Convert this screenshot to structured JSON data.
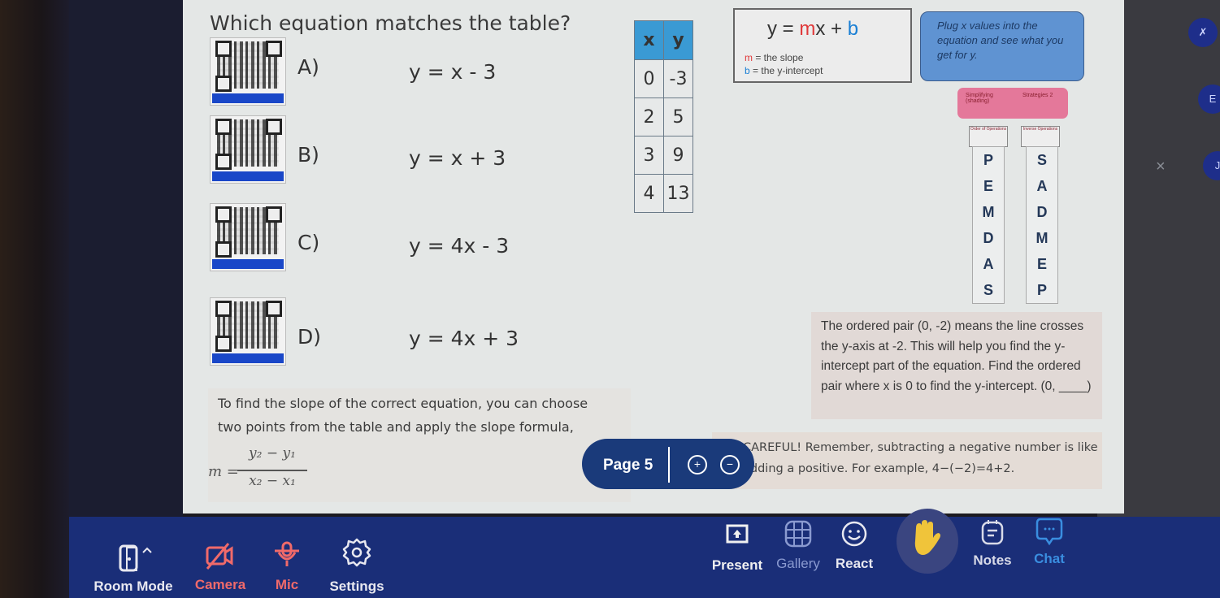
{
  "question": {
    "title": "Which equation matches the table?",
    "options": [
      {
        "letter": "A)",
        "equation": "y = x - 3"
      },
      {
        "letter": "B)",
        "equation": "y = x + 3"
      },
      {
        "letter": "C)",
        "equation": "y = 4x - 3"
      },
      {
        "letter": "D)",
        "equation": "y = 4x + 3"
      }
    ]
  },
  "table": {
    "headers": [
      "x",
      "y"
    ],
    "rows": [
      [
        "0",
        "-3"
      ],
      [
        "2",
        "5"
      ],
      [
        "3",
        "9"
      ],
      [
        "4",
        "13"
      ]
    ]
  },
  "formula_box": {
    "y_eq": "y = ",
    "m": "m",
    "x_plus": "x + ",
    "b": "b",
    "m_label": "m",
    "m_def": " = the slope",
    "b_label": "b",
    "b_def": " = the y-intercept"
  },
  "plug_box": {
    "text": "Plug x values into the equation and see what you get for y."
  },
  "strategy_box": {
    "left": "Simplifying (shading)",
    "right": "Strategies 2"
  },
  "pemdas": {
    "left_header": "Order of Operations",
    "right_header": "Inverse Operations",
    "left_letters": [
      "P",
      "E",
      "M",
      "D",
      "A",
      "S"
    ],
    "right_letters": [
      "S",
      "A",
      "D",
      "M",
      "E",
      "P"
    ]
  },
  "ordered_pair_box": {
    "text": "The ordered pair (0, -2) means the line crosses the y-axis at -2.  This will help you find the y-intercept part of the equation.   Find the ordered pair where x is 0 to find the y-intercept.  (0, ____)"
  },
  "slope_box": {
    "line1": "To find the slope of the correct equation, you can choose",
    "line2": "two points from the table and apply the slope formula,",
    "m_eq": "m =",
    "numerator": "y₂ − y₁",
    "denominator": "x₂ − x₁"
  },
  "careful_box": {
    "text": "CAREFUL!   Remember, subtracting a negative number is like adding a positive. For example, 4−(−2)=4+2."
  },
  "page_pill": {
    "label": "Page 5",
    "zoom_in": "+",
    "zoom_out": "−"
  },
  "toolbar": {
    "room_mode": "Room Mode",
    "camera": "Camera",
    "mic": "Mic",
    "settings": "Settings",
    "present": "Present",
    "gallery": "Gallery",
    "react": "React",
    "notes": "Notes",
    "chat": "Chat"
  },
  "side_buttons": {
    "close": "×"
  },
  "colors": {
    "toolbar_bg": "#1a2e78",
    "muted_red": "#f06a6a",
    "chat_blue": "#3a8ee0",
    "slope_red": "#e0393a",
    "intercept_blue": "#1a7fd4"
  }
}
